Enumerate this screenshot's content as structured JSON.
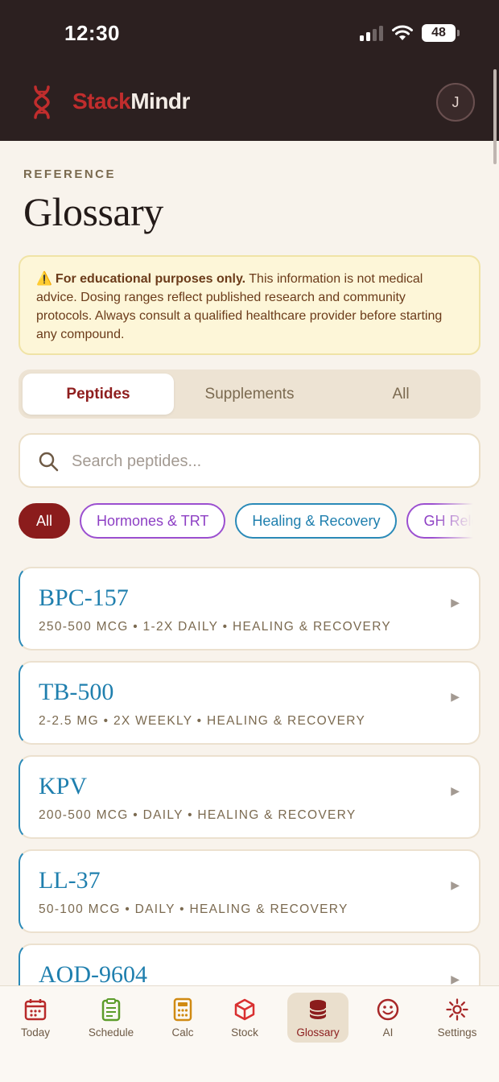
{
  "status": {
    "time": "12:30",
    "battery": "48"
  },
  "app": {
    "brand_part1": "Stack",
    "brand_part2": "Mindr",
    "avatar_initial": "J"
  },
  "page": {
    "eyebrow": "REFERENCE",
    "title": "Glossary"
  },
  "notice": {
    "bold": "For educational purposes only.",
    "text": "This information is not medical advice. Dosing ranges reflect published research and community protocols. Always consult a qualified healthcare provider before starting any compound."
  },
  "tabs": {
    "peptides": "Peptides",
    "supplements": "Supplements",
    "all": "All"
  },
  "search": {
    "placeholder": "Search peptides..."
  },
  "chips": {
    "all": "All",
    "hormones": "Hormones & TRT",
    "healing": "Healing & Recovery",
    "gh": "GH Releasers"
  },
  "peptides": [
    {
      "name": "BPC-157",
      "meta": "250-500 MCG • 1-2X DAILY • HEALING & RECOVERY"
    },
    {
      "name": "TB-500",
      "meta": "2-2.5 MG • 2X WEEKLY • HEALING & RECOVERY"
    },
    {
      "name": "KPV",
      "meta": "200-500 MCG • DAILY • HEALING & RECOVERY"
    },
    {
      "name": "LL-37",
      "meta": "50-100 MCG • DAILY • HEALING & RECOVERY"
    },
    {
      "name": "AOD-9604",
      "meta": ""
    }
  ],
  "nav": {
    "today": "Today",
    "schedule": "Schedule",
    "calc": "Calc",
    "stock": "Stock",
    "glossary": "Glossary",
    "ai": "AI",
    "settings": "Settings"
  },
  "colors": {
    "brand_red": "#c12d2d",
    "accent_blue": "#1f7fae",
    "dark_header": "#2c2020"
  }
}
